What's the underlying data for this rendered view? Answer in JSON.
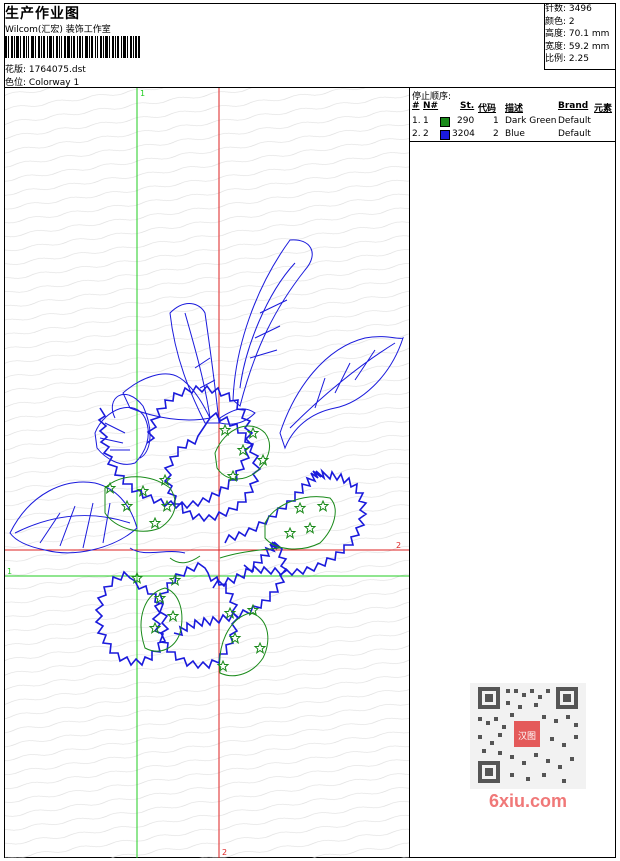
{
  "header": {
    "title": "生产作业图",
    "company": "Wilcom(汇宏) 装饰工作室",
    "design_label": "花版:",
    "design_value": "1764075.dst",
    "colorway_label": "色位:",
    "colorway_value": "Colorway 1"
  },
  "stats": [
    {
      "label": "针数:",
      "value": "3496"
    },
    {
      "label": "颜色:",
      "value": "2"
    },
    {
      "label": "高度:",
      "value": "70.1 mm"
    },
    {
      "label": "宽度:",
      "value": "59.2 mm"
    },
    {
      "label": "比例:",
      "value": "2.25"
    }
  ],
  "stop_sequence": {
    "title": "停止顺序:",
    "columns": [
      "#",
      "N#",
      "St.",
      "代码",
      "描述",
      "Brand",
      "元素"
    ],
    "rows": [
      {
        "idx": "1.",
        "n": "1",
        "color": "#1a8a1a",
        "stitches": "290",
        "code": "1",
        "desc": "Dark Green",
        "brand": "Default"
      },
      {
        "idx": "2.",
        "n": "2",
        "color": "#1a1adc",
        "stitches": "3204",
        "code": "2",
        "desc": "Blue",
        "brand": "Default"
      }
    ]
  },
  "axes": {
    "green_label": "1",
    "red_label": "2",
    "green_color": "#22cc22",
    "red_color": "#dd2222"
  },
  "watermark": {
    "site": "6xiu.com",
    "badge": "汉图"
  }
}
